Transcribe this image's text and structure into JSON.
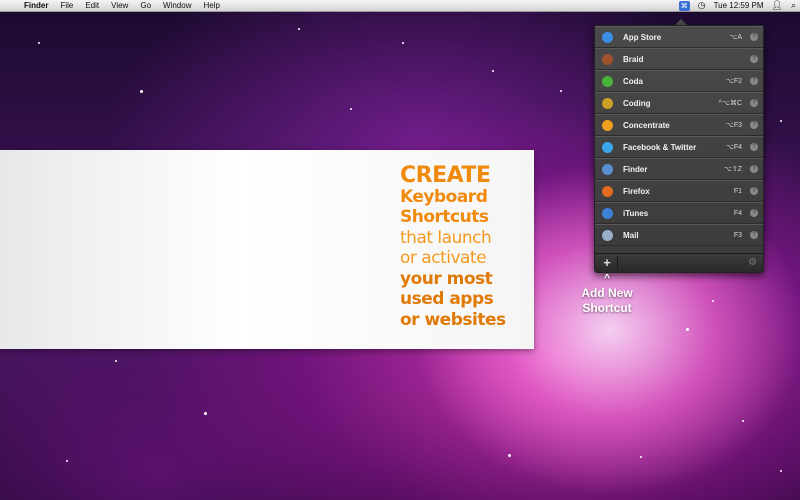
{
  "menubar": {
    "app_name": "Finder",
    "menus": [
      "File",
      "Edit",
      "View",
      "Go",
      "Window",
      "Help"
    ],
    "clock": "Tue 12:59 PM"
  },
  "promo": {
    "lines": [
      "CREATE",
      "Keyboard",
      "Shortcuts",
      "that launch",
      "or activate",
      "your most",
      "used apps",
      "or websites"
    ],
    "colors": {
      "orange": "#f08a0c",
      "orange_light": "#f39a1e"
    }
  },
  "menu": {
    "items": [
      {
        "label": "App Store",
        "shortcut": "⌥A",
        "icon": "app-store-icon",
        "color": "#3a8ee6"
      },
      {
        "label": "Braid",
        "shortcut": "",
        "icon": "braid-icon",
        "color": "#a0522d"
      },
      {
        "label": "Coda",
        "shortcut": "⌥F2",
        "icon": "coda-icon",
        "color": "#47b33a"
      },
      {
        "label": "Coding",
        "shortcut": "^⌥⌘C",
        "icon": "coding-icon",
        "color": "#c9a227"
      },
      {
        "label": "Concentrate",
        "shortcut": "⌥F3",
        "icon": "concentrate-icon",
        "color": "#f0a020"
      },
      {
        "label": "Facebook & Twitter",
        "shortcut": "⌥F4",
        "icon": "facebook-twitter-icon",
        "color": "#3ba7e8"
      },
      {
        "label": "Finder",
        "shortcut": "⌥⇧Z",
        "icon": "finder-icon",
        "color": "#5a8fd0"
      },
      {
        "label": "Firefox",
        "shortcut": "F1",
        "icon": "firefox-icon",
        "color": "#e36a1f"
      },
      {
        "label": "iTunes",
        "shortcut": "F4",
        "icon": "itunes-icon",
        "color": "#3b82d6"
      },
      {
        "label": "Mail",
        "shortcut": "F3",
        "icon": "mail-icon",
        "color": "#9ab0c8"
      }
    ],
    "add_label": "+"
  },
  "callout": {
    "text_line1": "Add New",
    "text_line2": "Shortcut"
  }
}
